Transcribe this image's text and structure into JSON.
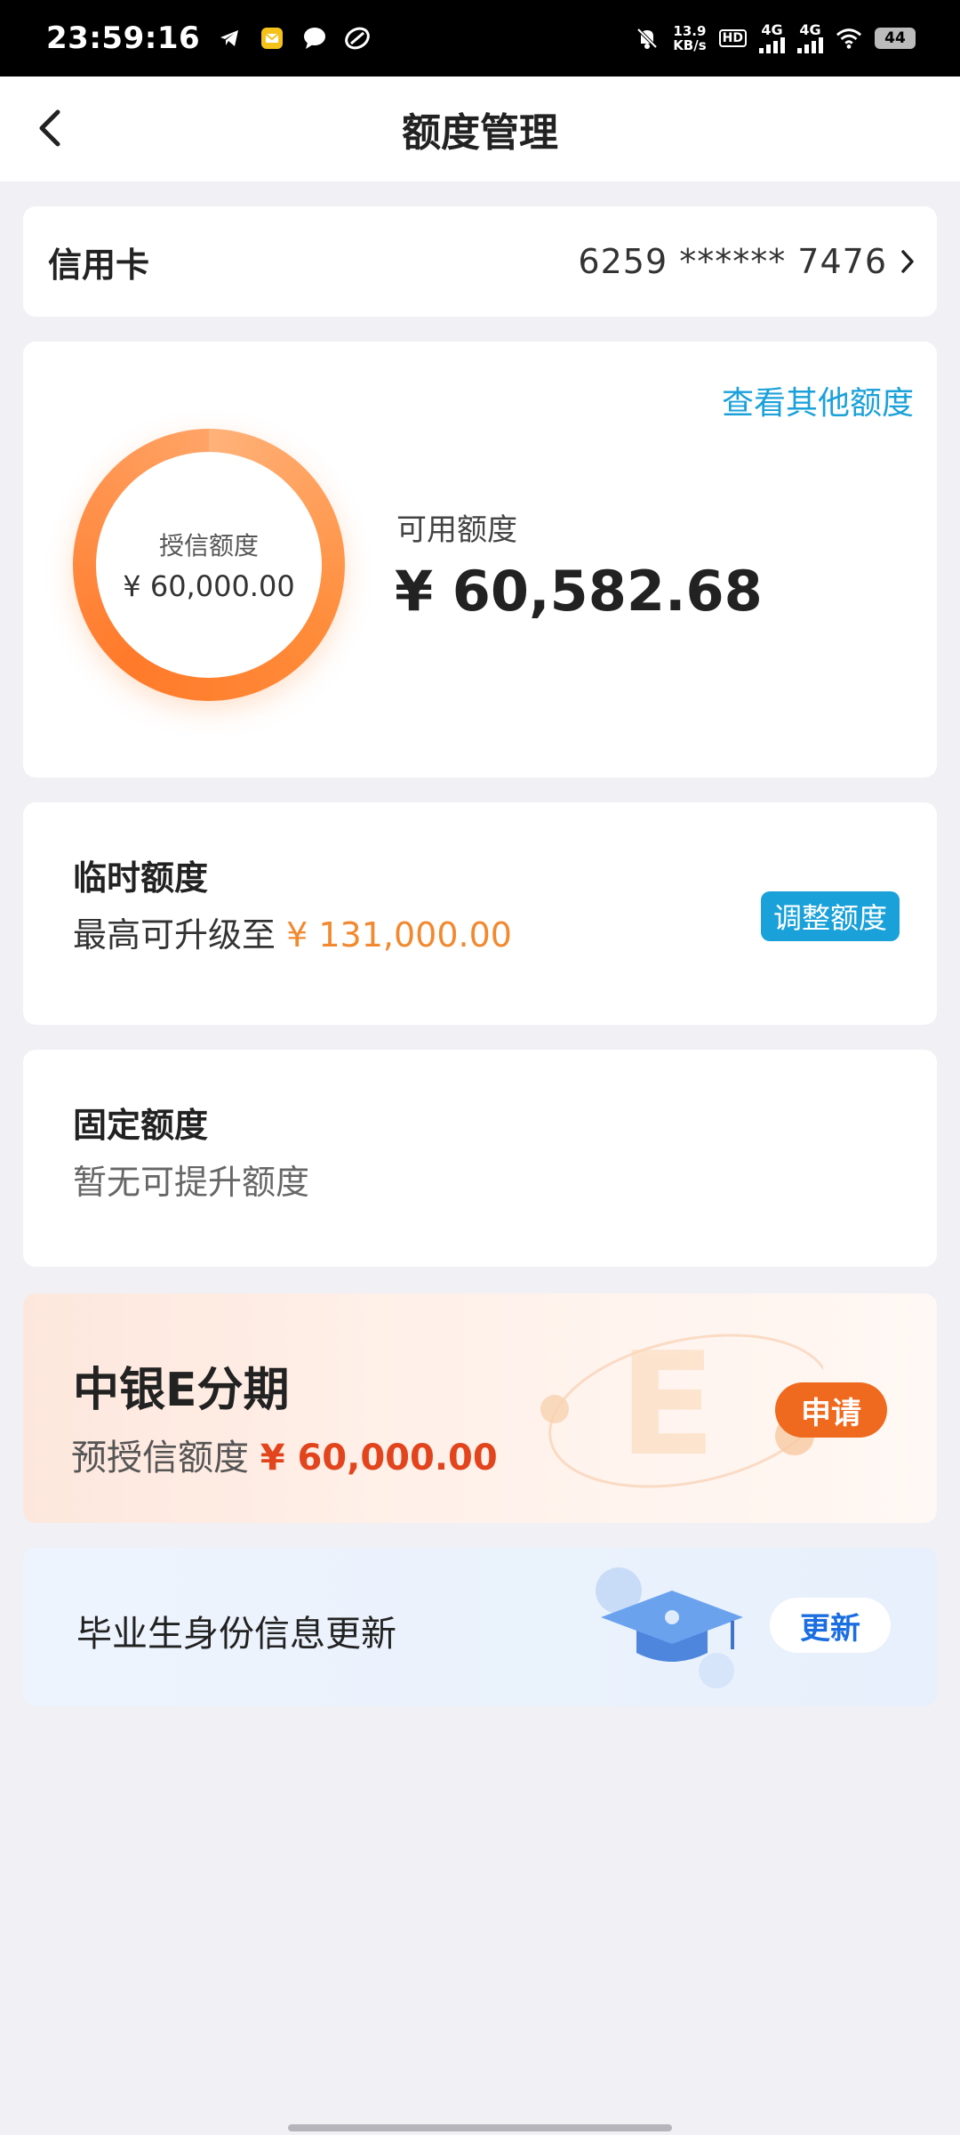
{
  "status_bar": {
    "time": "23:59:16",
    "net_speed_value": "13.9",
    "net_speed_unit": "KB/s",
    "hd_label": "HD",
    "signal1_label": "4G",
    "signal2_label": "4G",
    "battery": "44"
  },
  "nav": {
    "title": "额度管理"
  },
  "card_row": {
    "card_type": "信用卡",
    "card_number": "6259 ****** 7476"
  },
  "limit": {
    "other_link": "查看其他额度",
    "ring_label": "授信额度",
    "ring_value": "¥ 60,000.00",
    "available_label": "可用额度",
    "available_value": "¥ 60,582.68"
  },
  "temporary": {
    "title": "临时额度",
    "subtitle_prefix": "最高可升级至 ",
    "amount": "¥ 131,000.00",
    "button": "调整额度"
  },
  "fixed": {
    "title": "固定额度",
    "subtitle": "暂无可提升额度"
  },
  "installment": {
    "title": "中银E分期",
    "subtitle_prefix": "预授信额度 ",
    "amount": "¥ 60,000.00",
    "deco_letter": "E",
    "button": "申请"
  },
  "graduate": {
    "text": "毕业生身份信息更新",
    "button": "更新"
  },
  "colors": {
    "accent_blue": "#1ba1d9",
    "orange": "#f2892e",
    "red_orange": "#e2451d",
    "apply_orange": "#ef6a1e",
    "update_blue": "#1a6ee0"
  }
}
